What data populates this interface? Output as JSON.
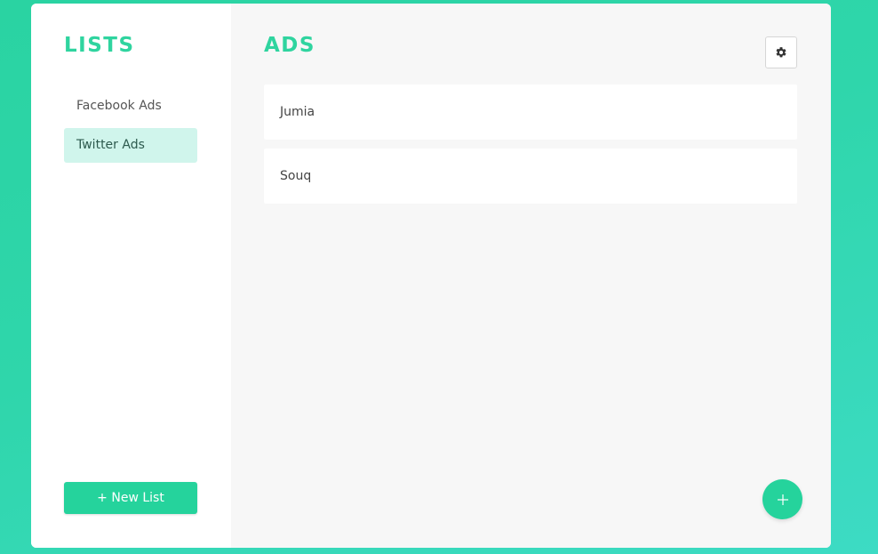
{
  "sidebar": {
    "title": "LISTS",
    "items": [
      {
        "label": "Facebook Ads",
        "active": false
      },
      {
        "label": "Twitter Ads",
        "active": true
      }
    ],
    "new_list_label": "+ New List"
  },
  "main": {
    "title": "ADS",
    "ads": [
      {
        "name": "Jumia"
      },
      {
        "name": "Souq"
      }
    ],
    "settings_icon": "gear-icon",
    "add_icon": "plus-icon"
  },
  "colors": {
    "accent": "#2fd49f",
    "active_item_bg": "#d0f5ec",
    "background_gradient_start": "#2ad3a2",
    "background_gradient_end": "#3ddbc4"
  }
}
